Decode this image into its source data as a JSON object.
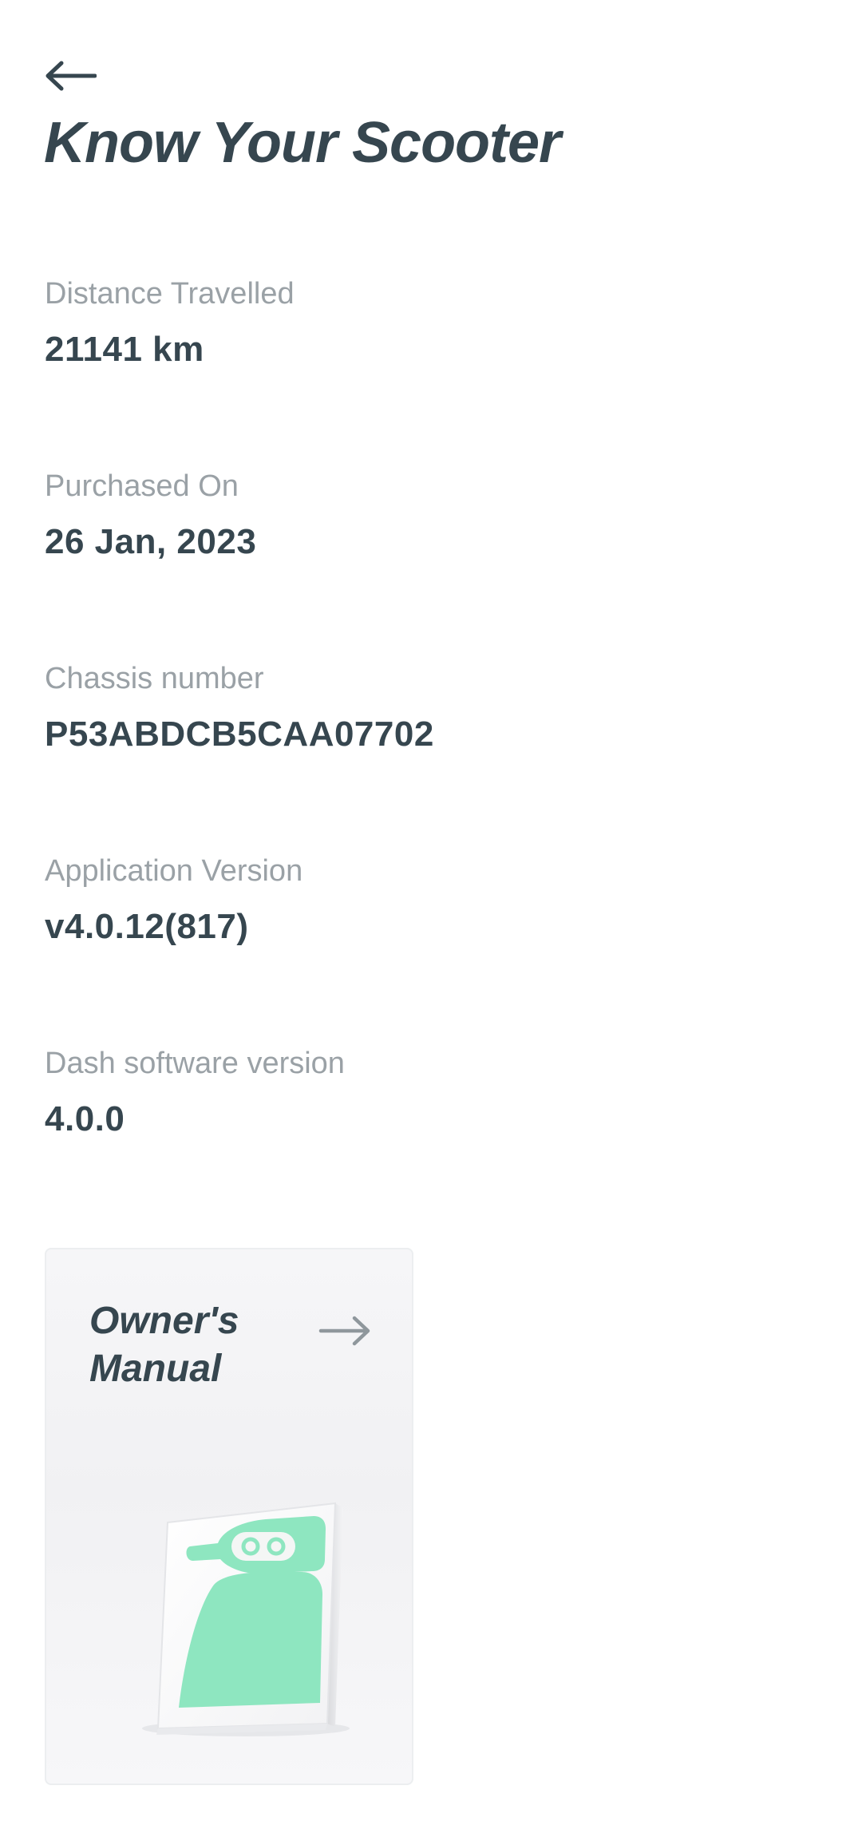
{
  "header": {
    "back_icon": "arrow-left-icon",
    "title": "Know Your Scooter"
  },
  "details": [
    {
      "label": "Distance Travelled",
      "value": "21141 km"
    },
    {
      "label": "Purchased On",
      "value": "26 Jan, 2023"
    },
    {
      "label": "Chassis number",
      "value": "P53ABDCB5CAA07702"
    },
    {
      "label": "Application Version",
      "value": "v4.0.12(817)"
    },
    {
      "label": "Dash software version",
      "value": "4.0.0"
    }
  ],
  "manual_card": {
    "title_line1": "Owner's",
    "title_line2": "Manual",
    "arrow_icon": "arrow-right-icon",
    "illustration": "manual-book-icon"
  },
  "colors": {
    "text_dark": "#36464f",
    "text_muted": "#9aa1a6",
    "accent_mint": "#8ee6c0",
    "background": "#ffffff"
  }
}
